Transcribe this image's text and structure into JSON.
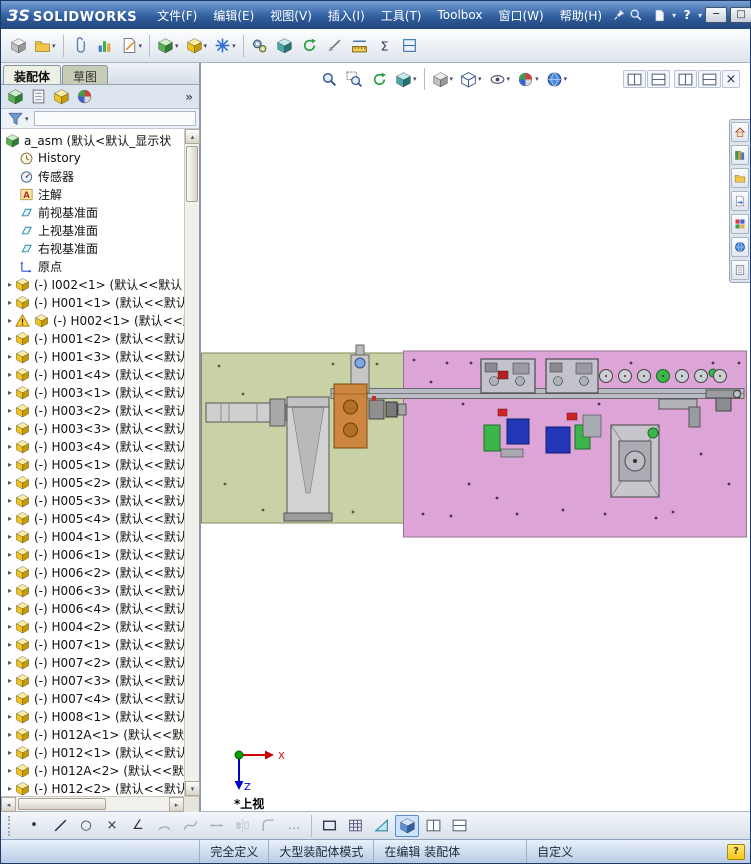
{
  "titlebar": {
    "logo_mark": "ЗS",
    "brand": "SOLIDWORKS",
    "menus": [
      {
        "label": "文件(F)",
        "name": "menu-file"
      },
      {
        "label": "编辑(E)",
        "name": "menu-edit"
      },
      {
        "label": "视图(V)",
        "name": "menu-view"
      },
      {
        "label": "插入(I)",
        "name": "menu-insert"
      },
      {
        "label": "工具(T)",
        "name": "menu-tools"
      },
      {
        "label": "Toolbox",
        "name": "menu-toolbox"
      },
      {
        "label": "窗口(W)",
        "name": "menu-window"
      },
      {
        "label": "帮助(H)",
        "name": "menu-help"
      }
    ],
    "help_glyph": "?",
    "window_buttons": {
      "minimize": "─",
      "maximize": "□",
      "close": "×"
    }
  },
  "panel": {
    "tabs": [
      {
        "label": "装配体",
        "name": "tab-assembly",
        "active": true
      },
      {
        "label": "草图",
        "name": "tab-sketch",
        "active": false
      }
    ],
    "root": "a_asm (默认<默认_显示状",
    "folders": [
      {
        "label": "History",
        "name": "history",
        "icon": "clock"
      },
      {
        "label": "传感器",
        "name": "sensors",
        "icon": "gauge"
      },
      {
        "label": "注解",
        "name": "annotations",
        "icon": "noteA"
      },
      {
        "label": "前视基准面",
        "name": "front-plane",
        "icon": "plane"
      },
      {
        "label": "上视基准面",
        "name": "top-plane",
        "icon": "plane"
      },
      {
        "label": "右视基准面",
        "name": "right-plane",
        "icon": "plane"
      },
      {
        "label": "原点",
        "name": "origin",
        "icon": "origin"
      }
    ],
    "components": [
      {
        "label": "(-) I002<1> (默认<<默认"
      },
      {
        "label": "(-) H001<1> (默认<<默认"
      },
      {
        "label": "(-) H002<1> (默认<<默",
        "warning": true
      },
      {
        "label": "(-) H001<2> (默认<<默认"
      },
      {
        "label": "(-) H001<3> (默认<<默认"
      },
      {
        "label": "(-) H001<4> (默认<<默认"
      },
      {
        "label": "(-) H003<1> (默认<<默认"
      },
      {
        "label": "(-) H003<2> (默认<<默认"
      },
      {
        "label": "(-) H003<3> (默认<<默认"
      },
      {
        "label": "(-) H003<4> (默认<<默认"
      },
      {
        "label": "(-) H005<1> (默认<<默认"
      },
      {
        "label": "(-) H005<2> (默认<<默认"
      },
      {
        "label": "(-) H005<3> (默认<<默认"
      },
      {
        "label": "(-) H005<4> (默认<<默认"
      },
      {
        "label": "(-) H004<1> (默认<<默认"
      },
      {
        "label": "(-) H006<1> (默认<<默认"
      },
      {
        "label": "(-) H006<2> (默认<<默认"
      },
      {
        "label": "(-) H006<3> (默认<<默认"
      },
      {
        "label": "(-) H006<4> (默认<<默认"
      },
      {
        "label": "(-) H004<2> (默认<<默认"
      },
      {
        "label": "(-) H007<1> (默认<<默认"
      },
      {
        "label": "(-) H007<2> (默认<<默认"
      },
      {
        "label": "(-) H007<3> (默认<<默认"
      },
      {
        "label": "(-) H007<4> (默认<<默认"
      },
      {
        "label": "(-) H008<1> (默认<<默认"
      },
      {
        "label": "(-) H012A<1> (默认<<默认"
      },
      {
        "label": "(-) H012<1> (默认<<默认"
      },
      {
        "label": "(-) H012A<2> (默认<<默认"
      },
      {
        "label": "(-) H012<2> (默认<<默认"
      }
    ]
  },
  "viewport": {
    "view_label": "*上视",
    "axis_x": "X",
    "axis_z": "Z"
  },
  "statusbar": {
    "cells": [
      {
        "label": "完全定义",
        "name": "status-fully-defined"
      },
      {
        "label": "大型装配体模式",
        "name": "status-large-assembly-mode"
      },
      {
        "label": "在编辑 装配体",
        "name": "status-editing-assembly"
      },
      {
        "label": "自定义",
        "name": "status-customize"
      }
    ]
  },
  "toolbars": {
    "main": [
      {
        "name": "new-assembly-icon",
        "t": "cube",
        "c": "gray"
      },
      {
        "name": "open-icon",
        "t": "folder",
        "dd": true
      },
      {
        "sep": true
      },
      {
        "name": "mate-icon",
        "t": "clip"
      },
      {
        "name": "assembly-statistics-icon",
        "t": "bars"
      },
      {
        "name": "edit-component-icon",
        "t": "docpencil",
        "dd": true
      },
      {
        "sep": true
      },
      {
        "name": "insert-component-icon",
        "t": "cube",
        "c": "green",
        "dd": true
      },
      {
        "name": "component-pattern-icon",
        "t": "cube",
        "c": "yellow",
        "dd": true
      },
      {
        "name": "smart-fasteners-icon",
        "t": "star",
        "dd": true
      },
      {
        "sep": true
      },
      {
        "name": "move-component-icon",
        "t": "gears"
      },
      {
        "name": "show-hidden-components-icon",
        "t": "cube",
        "c": "teal"
      },
      {
        "name": "rotate-component-icon",
        "t": "rotate"
      },
      {
        "name": "interference-detection-icon",
        "t": "knife"
      },
      {
        "name": "measure-icon",
        "t": "ruler"
      },
      {
        "name": "mass-properties-icon",
        "t": "sigma"
      },
      {
        "name": "section-properties-icon",
        "t": "secdoc"
      }
    ],
    "headsup": [
      {
        "name": "zoom-fit-icon",
        "t": "mag"
      },
      {
        "name": "zoom-area-icon",
        "t": "magrect"
      },
      {
        "name": "previous-view-icon",
        "t": "rotate"
      },
      {
        "name": "section-view-icon",
        "t": "cube",
        "c": "teal",
        "dd": true
      },
      {
        "sep": true
      },
      {
        "name": "view-orientation-icon",
        "t": "cube",
        "c": "gray",
        "dd": true
      },
      {
        "name": "display-style-icon",
        "t": "cubew",
        "dd": true
      },
      {
        "name": "hide-show-items-icon",
        "t": "eye",
        "dd": true
      },
      {
        "name": "edit-appearance-icon",
        "t": "sphere4",
        "dd": true
      },
      {
        "name": "apply-scene-icon",
        "t": "globe",
        "dd": true
      }
    ],
    "headsup_right": [
      {
        "name": "view-setting-pane-icon",
        "t": "pane1"
      },
      {
        "name": "view-setting-pane2-icon",
        "t": "pane2"
      }
    ],
    "headsup_far": [
      {
        "name": "split-pane-icon",
        "t": "pane1"
      },
      {
        "name": "split-pane2-icon",
        "t": "pane2"
      },
      {
        "name": "close-pane-icon",
        "g": "×"
      }
    ],
    "panel_icons": [
      {
        "name": "featuremanager-tab-icon",
        "t": "cube",
        "c": "green"
      },
      {
        "name": "propertymanager-tab-icon",
        "t": "sheet"
      },
      {
        "name": "configurationmanager-tab-icon",
        "t": "cube",
        "c": "yellow"
      },
      {
        "name": "displaymanager-tab-icon",
        "t": "sphere4"
      }
    ],
    "task_pane": [
      {
        "name": "resources-tab-icon",
        "t": "home"
      },
      {
        "name": "design-library-tab-icon",
        "t": "lib"
      },
      {
        "name": "file-explorer-tab-icon",
        "t": "folder"
      },
      {
        "name": "view-palette-tab-icon",
        "t": "docarr"
      },
      {
        "name": "appearances-tab-icon",
        "t": "palette"
      },
      {
        "name": "scenes-tab-icon",
        "t": "globe"
      },
      {
        "name": "custom-properties-tab-icon",
        "t": "sheet"
      }
    ],
    "sketch": [
      {
        "handle": true
      },
      {
        "name": "point-tool-icon",
        "g": "•"
      },
      {
        "name": "line-tool-icon",
        "t": "lineI"
      },
      {
        "name": "circle-tool-icon",
        "g": "○"
      },
      {
        "name": "trim-tool-icon",
        "g": "×"
      },
      {
        "name": "angle-tool-icon",
        "g": "∠"
      },
      {
        "name": "arc-tool-icon",
        "t": "arcI",
        "dis": true
      },
      {
        "name": "spline-tool-icon",
        "t": "splineI",
        "dis": true
      },
      {
        "name": "dimension-tool-icon",
        "t": "dimI",
        "dis": true
      },
      {
        "name": "mirror-tool-icon",
        "t": "mirI",
        "dis": true
      },
      {
        "name": "fillet-tool-icon",
        "t": "filI",
        "dis": true
      },
      {
        "name": "more-tools-icon",
        "g": "…",
        "dis": true
      },
      {
        "sep": true
      },
      {
        "name": "rectangle-tool-icon",
        "t": "rectI"
      },
      {
        "name": "grid-tool-icon",
        "t": "gridI"
      },
      {
        "name": "plane-tool-icon",
        "t": "triI"
      },
      {
        "name": "shaded-view-icon",
        "t": "cube",
        "c": "blue",
        "active": true
      },
      {
        "name": "viewport-pane-icon",
        "t": "pane1"
      },
      {
        "name": "viewport-pane2-icon",
        "t": "pane2"
      }
    ]
  }
}
